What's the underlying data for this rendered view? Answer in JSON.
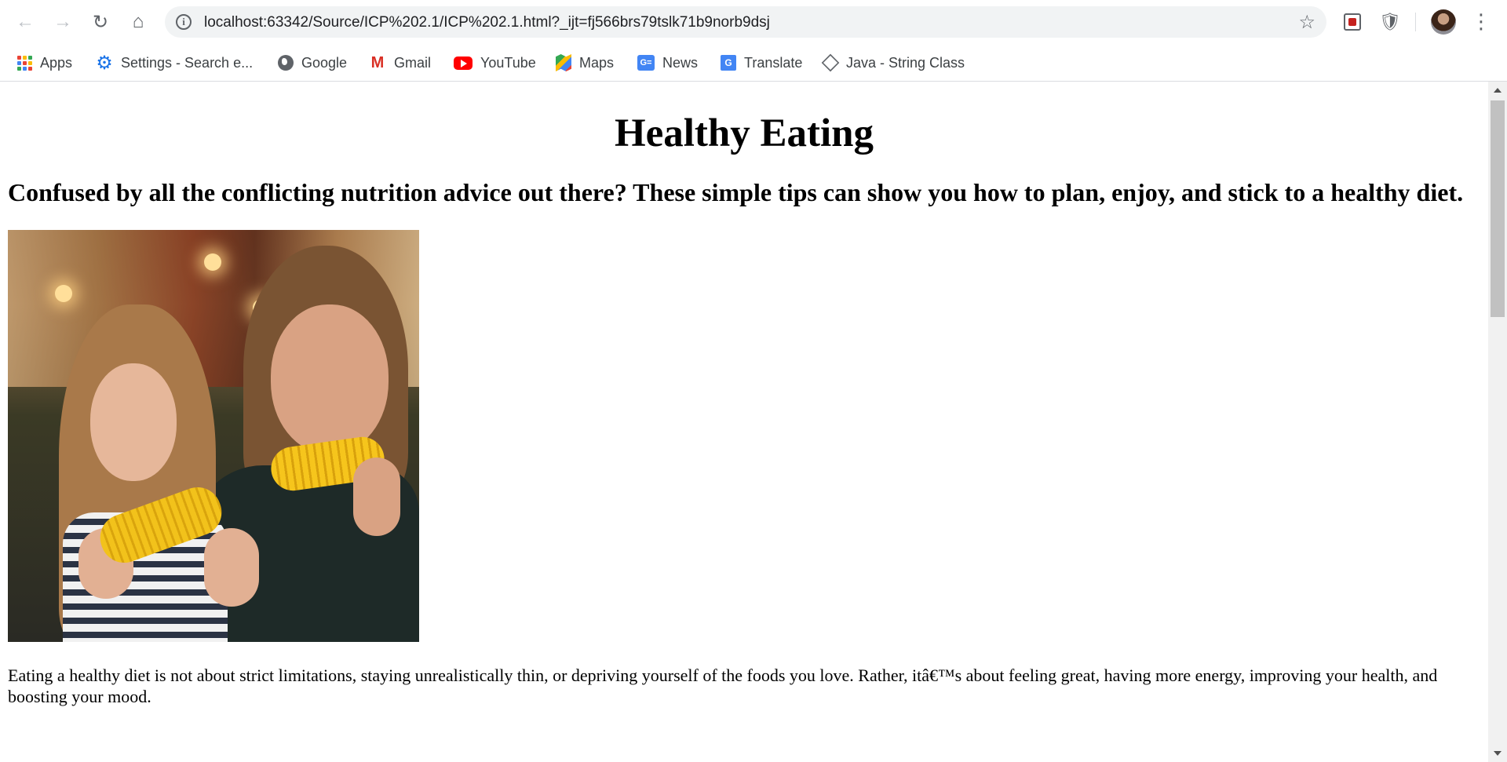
{
  "browser": {
    "nav": {
      "back_icon": "back-arrow-icon",
      "forward_icon": "forward-arrow-icon",
      "reload_icon": "reload-icon",
      "home_icon": "home-icon"
    },
    "address_bar": {
      "url": "localhost:63342/Source/ICP%202.1/ICP%202.1.html?_ijt=fj566brs79tslk71b9norb9dsj",
      "info_glyph": "i"
    },
    "extensions": [
      "mcafee-icon",
      "shield-icon"
    ],
    "bookmarks": [
      {
        "label": "Apps",
        "icon": "apps-grid-icon"
      },
      {
        "label": "Settings - Search e...",
        "icon": "gear-icon"
      },
      {
        "label": "Google",
        "icon": "globe-icon"
      },
      {
        "label": "Gmail",
        "icon": "gmail-icon"
      },
      {
        "label": "YouTube",
        "icon": "youtube-icon"
      },
      {
        "label": "Maps",
        "icon": "maps-icon"
      },
      {
        "label": "News",
        "icon": "news-icon"
      },
      {
        "label": "Translate",
        "icon": "translate-icon"
      },
      {
        "label": "Java - String Class",
        "icon": "java-diamond-icon"
      }
    ]
  },
  "page": {
    "title": "Healthy Eating",
    "subtitle": "Confused by all the conflicting nutrition advice out there? These simple tips can show you how to plan, enjoy, and stick to a healthy diet.",
    "image_alt": "",
    "paragraph": "Eating a healthy diet is not about strict limitations, staying unrealistically thin, or depriving yourself of the foods you love. Rather, itâ€™s about feeling great, having more energy, improving your health, and boosting your mood."
  },
  "colors": {
    "chrome_bg": "#ffffff",
    "omnibox_bg": "#f1f3f4",
    "icon_gray": "#5f6368",
    "accent_blue": "#1a73e8",
    "gmail_red": "#d93025",
    "youtube_red": "#ff0000"
  }
}
